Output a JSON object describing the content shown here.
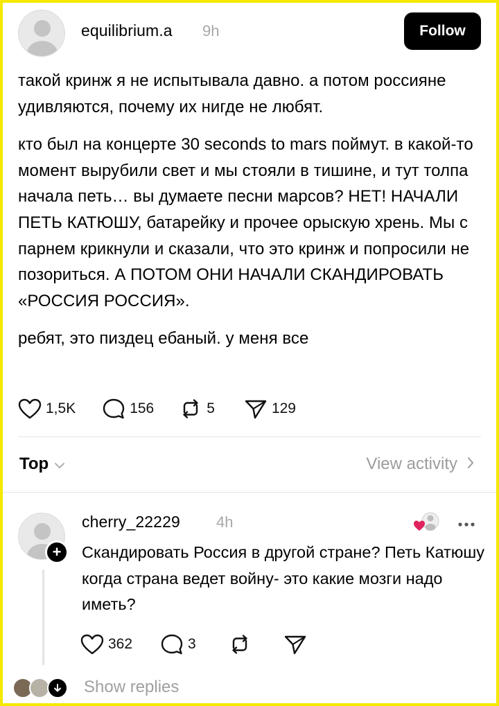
{
  "post": {
    "username": "equilibrium.a",
    "time": "9h",
    "follow_label": "Follow",
    "paragraphs": [
      "такой кринж я не испытывала давно. а потом россияне удивляются, почему их нигде не любят.",
      "кто был на концерте 30 seconds to mars поймут. в какой-то момент вырубили свет и мы стояли в тишине, и тут толпа начала петь… вы думаете песни марсов? НЕТ! НАЧАЛИ ПЕТЬ КАТЮШУ, батарейку и прочее орыскую хрень. Мы с парнем крикнули и сказали, что это кринж и попросили не позориться. А ПОТОМ ОНИ НАЧАЛИ СКАНДИРОВАТЬ «РОССИЯ РОССИЯ».",
      "ребят, это пиздец ебаный. у меня все"
    ],
    "likes": "1,5K",
    "comments": "156",
    "reposts": "5",
    "shares": "129"
  },
  "sort": {
    "label": "Top",
    "view_activity": "View activity"
  },
  "reply": {
    "username": "cherry_22229",
    "time": "4h",
    "text": "Скандировать Россия в другой стране? Петь Катюшу когда страна ведет войну- это какие мозги надо иметь?",
    "likes": "362",
    "comments": "3",
    "show_replies": "Show replies"
  },
  "icons": {
    "like": "heart-icon",
    "comment": "comment-bubble-icon",
    "repost": "repost-icon",
    "share": "send-icon",
    "more": "more-dots-icon",
    "liked_by_author": "heart-avatar-icon",
    "sort_chevron": "chevron-down-icon",
    "activity_chevron": "chevron-right-icon",
    "follow_reply": "plus-icon",
    "expand": "arrow-down-icon"
  },
  "colors": {
    "accent_black": "#000000",
    "muted_gray": "#a8a8a8",
    "heart_red": "#e0245e",
    "frame_yellow": "#f5e900"
  }
}
